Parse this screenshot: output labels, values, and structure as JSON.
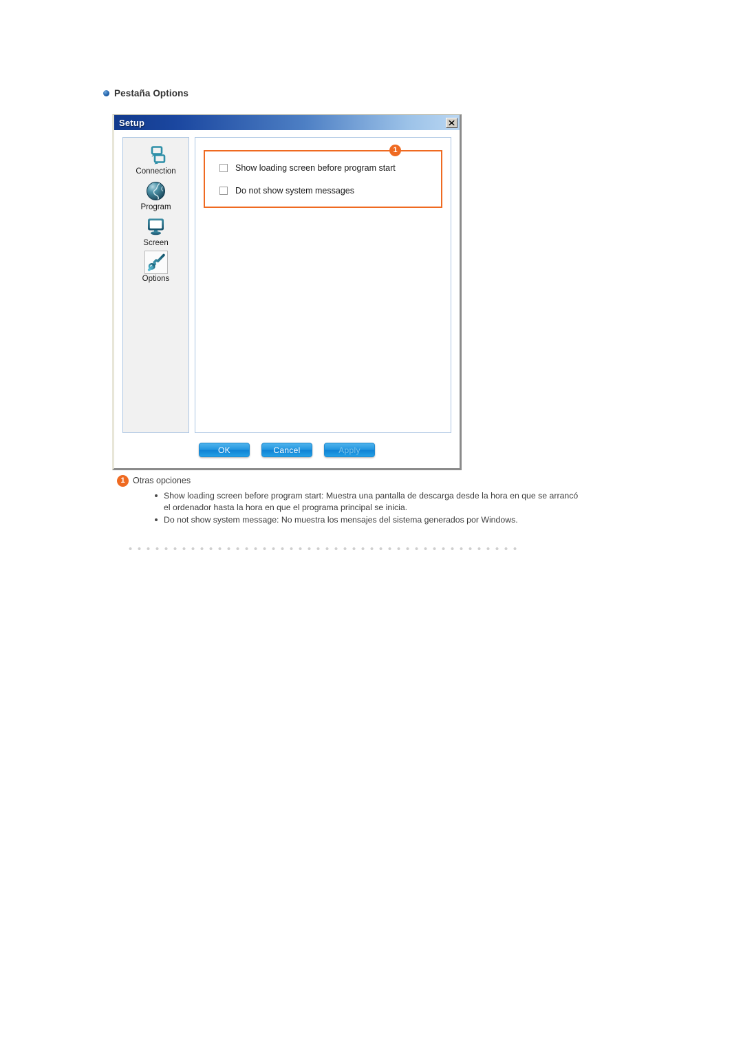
{
  "section": {
    "heading": "Pestaña Options",
    "bullet_icon": "blue-dot-icon",
    "accent_color": "#1f5fa8"
  },
  "dialog": {
    "title": "Setup",
    "close_icon": "close-icon",
    "sidebar": {
      "items": [
        {
          "label": "Connection",
          "icon": "connection-icon",
          "active": false
        },
        {
          "label": "Program",
          "icon": "globe-icon",
          "active": false
        },
        {
          "label": "Screen",
          "icon": "monitor-icon",
          "active": false
        },
        {
          "label": "Options",
          "icon": "wrench-icon",
          "active": true
        }
      ]
    },
    "options_panel": {
      "badge": "1",
      "highlight_color": "#ef6a21",
      "checkboxes": [
        {
          "label": "Show loading screen before program start",
          "checked": false
        },
        {
          "label": "Do not show system messages",
          "checked": false
        }
      ]
    },
    "buttons": [
      {
        "label": "OK",
        "disabled": false
      },
      {
        "label": "Cancel",
        "disabled": false
      },
      {
        "label": "Apply",
        "disabled": true
      }
    ]
  },
  "caption": {
    "badge": "1",
    "title": "Otras opciones",
    "items": [
      "Show loading screen before program start: Muestra una pantalla de descarga desde la hora en que se arrancó el ordenador hasta la hora en que el programa principal se inicia.",
      "Do not show system message: No muestra los mensajes del sistema generados por Windows."
    ]
  }
}
